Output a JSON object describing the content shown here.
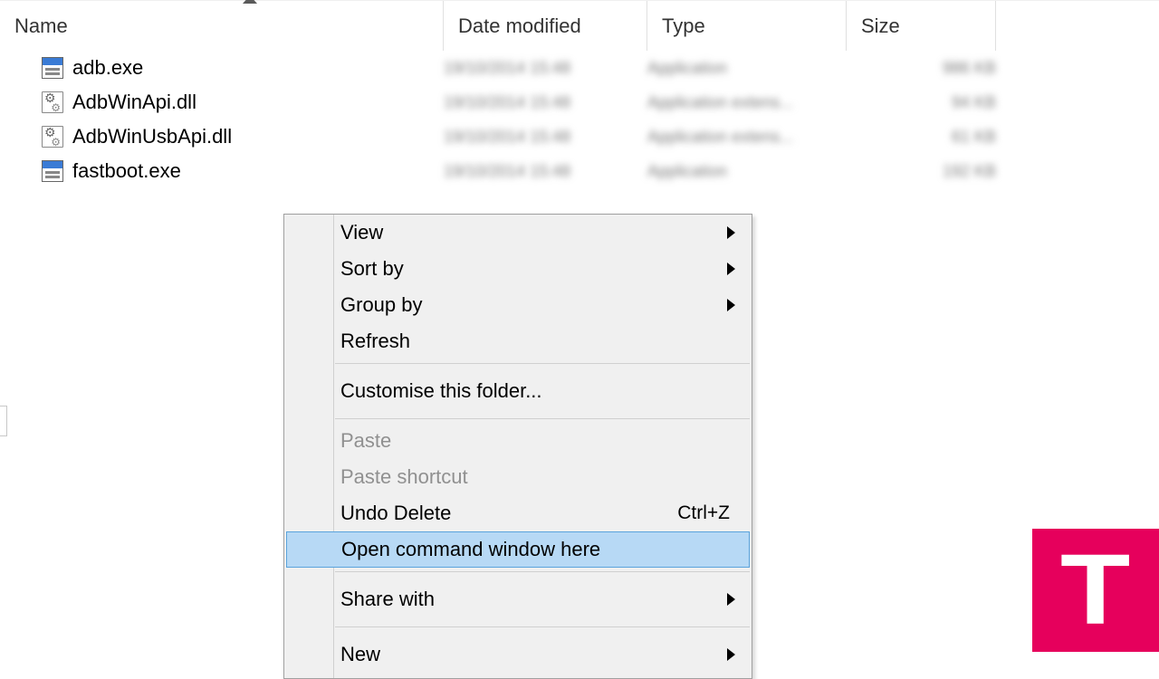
{
  "columns": {
    "name": "Name",
    "date": "Date modified",
    "type": "Type",
    "size": "Size"
  },
  "files": [
    {
      "name": "adb.exe",
      "icon": "exe",
      "date": "19/10/2014 15:48",
      "type": "Application",
      "size": "986 KB"
    },
    {
      "name": "AdbWinApi.dll",
      "icon": "dll",
      "date": "19/10/2014 15:48",
      "type": "Application extens...",
      "size": "94 KB"
    },
    {
      "name": "AdbWinUsbApi.dll",
      "icon": "dll",
      "date": "19/10/2014 15:48",
      "type": "Application extens...",
      "size": "61 KB"
    },
    {
      "name": "fastboot.exe",
      "icon": "exe",
      "date": "19/10/2014 15:48",
      "type": "Application",
      "size": "192 KB"
    }
  ],
  "ctx": {
    "view": "View",
    "sort": "Sort by",
    "group": "Group by",
    "refresh": "Refresh",
    "customise": "Customise this folder...",
    "paste": "Paste",
    "paste_shortcut": "Paste shortcut",
    "undo": "Undo Delete",
    "undo_key": "Ctrl+Z",
    "open_cmd": "Open command window here",
    "share": "Share with",
    "new": "New"
  },
  "brand_letter": "T"
}
